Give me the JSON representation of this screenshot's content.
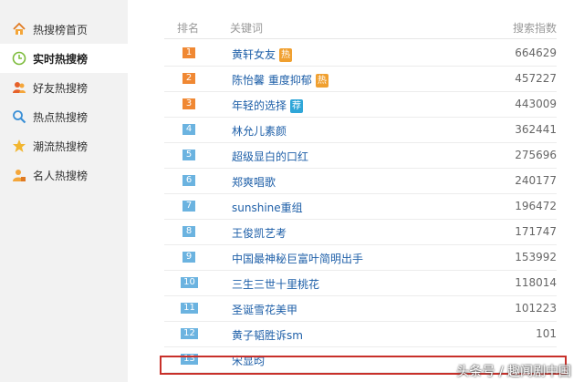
{
  "sidebar": {
    "items": [
      {
        "label": "热搜榜首页",
        "icon": "home-icon"
      },
      {
        "label": "实时热搜榜",
        "icon": "clock-icon",
        "active": true
      },
      {
        "label": "好友热搜榜",
        "icon": "friends-icon"
      },
      {
        "label": "热点热搜榜",
        "icon": "search-icon"
      },
      {
        "label": "潮流热搜榜",
        "icon": "star-icon"
      },
      {
        "label": "名人热搜榜",
        "icon": "celebrity-icon"
      }
    ]
  },
  "table": {
    "headers": {
      "rank": "排名",
      "keyword": "关键词",
      "index": "搜索指数"
    },
    "rows": [
      {
        "rank": "1",
        "keyword": "黄轩女友",
        "badge": "热",
        "index": "664629"
      },
      {
        "rank": "2",
        "keyword": "陈怡馨 重度抑郁",
        "badge": "热",
        "index": "457227"
      },
      {
        "rank": "3",
        "keyword": "年轻的选择",
        "badge": "荐",
        "index": "443009"
      },
      {
        "rank": "4",
        "keyword": "林允儿素颜",
        "index": "362441"
      },
      {
        "rank": "5",
        "keyword": "超级显白的口红",
        "index": "275696"
      },
      {
        "rank": "6",
        "keyword": "郑爽唱歌",
        "index": "240177"
      },
      {
        "rank": "7",
        "keyword": "sunshine重组",
        "index": "196472"
      },
      {
        "rank": "8",
        "keyword": "王俊凯艺考",
        "index": "171747"
      },
      {
        "rank": "9",
        "keyword": "中国最神秘巨富叶简明出手",
        "index": "153992"
      },
      {
        "rank": "10",
        "keyword": "三生三世十里桃花",
        "index": "118014"
      },
      {
        "rank": "11",
        "keyword": "圣诞雪花美甲",
        "index": "101223"
      },
      {
        "rank": "12",
        "keyword": "黄子韬胜诉sm",
        "index": "101"
      },
      {
        "rank": "13",
        "keyword": "宋显昀",
        "index": ""
      }
    ]
  },
  "colors": {
    "top_rank": "#f08833",
    "rank": "#6bb3e0",
    "link": "#1e5fa8",
    "hot_badge": "#f0a030",
    "rec_badge": "#2fa6d8",
    "highlight": "#c8302a"
  },
  "watermark": "头条号 / 趣闻剧中国"
}
